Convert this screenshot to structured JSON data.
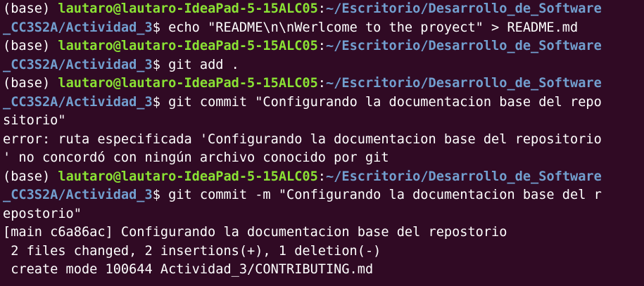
{
  "terminal": {
    "colors": {
      "background": "#300a24",
      "foreground": "#ffffff",
      "user": "#8ae234",
      "path": "#729fcf"
    },
    "lines": [
      {
        "env": "(base) ",
        "user": "lautaro@lautaro-IdeaPad-5-15ALC05",
        "colon": ":",
        "path": "~/Escritorio/Desarrollo_de_Software"
      },
      {
        "path": "_CC3S2A/Actividad_3",
        "text": "$ echo \"README\\n\\nWerlcome to the proyect\" > README.md"
      },
      {
        "env": "(base) ",
        "user": "lautaro@lautaro-IdeaPad-5-15ALC05",
        "colon": ":",
        "path": "~/Escritorio/Desarrollo_de_Software"
      },
      {
        "path": "_CC3S2A/Actividad_3",
        "text": "$ git add ."
      },
      {
        "env": "(base) ",
        "user": "lautaro@lautaro-IdeaPad-5-15ALC05",
        "colon": ":",
        "path": "~/Escritorio/Desarrollo_de_Software"
      },
      {
        "path": "_CC3S2A/Actividad_3",
        "text": "$ git commit \"Configurando la documentacion base del repo"
      },
      {
        "text": "sitorio\""
      },
      {
        "text": "error: ruta especificada 'Configurando la documentacion base del repositorio"
      },
      {
        "text": "' no concordó con ningún archivo conocido por git"
      },
      {
        "env": "(base) ",
        "user": "lautaro@lautaro-IdeaPad-5-15ALC05",
        "colon": ":",
        "path": "~/Escritorio/Desarrollo_de_Software"
      },
      {
        "path": "_CC3S2A/Actividad_3",
        "text": "$ git commit -m \"Configurando la documentacion base del r"
      },
      {
        "text": "epostorio\""
      },
      {
        "text": "[main c6a86ac] Configurando la documentacion base del repostorio"
      },
      {
        "text": " 2 files changed, 2 insertions(+), 1 deletion(-)"
      },
      {
        "text": " create mode 100644 Actividad_3/CONTRIBUTING.md"
      }
    ]
  }
}
